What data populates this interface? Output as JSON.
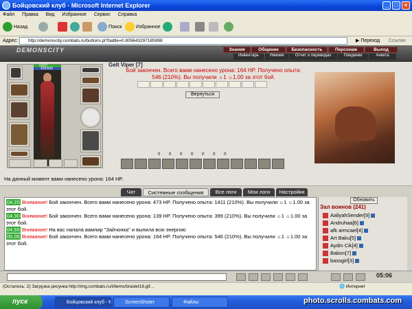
{
  "window": {
    "title": "Бойцовский клуб - Microsoft Internet Explorer"
  },
  "menu": [
    "Файл",
    "Правка",
    "Вид",
    "Избранное",
    "Сервис",
    "Справка"
  ],
  "toolbar": {
    "back": "Назад",
    "search": "Поиск",
    "favorites": "Избранное"
  },
  "address": {
    "label": "Адрес:",
    "url": "http://demonscity.combats.ru/buttons.pl?battle=0.805643297185998",
    "go": "Переход",
    "links": "Ссылки"
  },
  "game": {
    "logo": "DEMONSCITY",
    "nav_top": [
      "Знания",
      "Общение",
      "Безопасность",
      "Персонаж",
      "Выход"
    ],
    "nav_bottom": [
      "Инвентарь",
      "Умения",
      "Отчет о переводах",
      "Поединки",
      "Анкета"
    ]
  },
  "character": {
    "hp": "0/437",
    "mana": "459/600"
  },
  "battle": {
    "player": "Gelt Viper [7]",
    "line1": "Бой закончен. Всего вами нанесено урона: 164 HP. Получено опыта:",
    "line2": "546 (210%). Вы получили ☼1 ☼1.00 за этот бой.",
    "return_button": "Вернуться",
    "stats": [
      "0",
      "0",
      "0",
      "0",
      "0",
      "0",
      "0"
    ],
    "total_damage": "На данный момент вами нанесено урона: 164 HP."
  },
  "tabs": [
    "Чат",
    "Системные сообщения",
    "Все логи",
    "Мои логи",
    "Настройки"
  ],
  "chat": [
    {
      "time": "04.20",
      "warn": "Внимание!",
      "text": " Бой закончен. Всего вами нанесено урона: 473 HP. Получено опыта: 1411 (210%). Вы получили ☼1 ☼1.00 за этот бой."
    },
    {
      "time": "04.30",
      "warn": "Внимание!",
      "text": " Бой закончен. Всего вами нанесено урона: 139 HP. Получено опыта: 399 (210%). Вы получили ☼1 ☼1.00 за этот бой."
    },
    {
      "time": "04.55",
      "warn": "Внимание!",
      "text": " На вас напала вампир \"Зайчонка\" и выпила всю энергию"
    },
    {
      "time": "05.06",
      "warn": "Внимание!",
      "text": " Бой закончен. Всего вами нанесено урона: 164 HP. Получено опыта: 546 (210%). Вы получили ☼1 ☼1.00 за этот бой."
    }
  ],
  "players_panel": {
    "refresh": "Обновить",
    "room": "Зал воинов (241)",
    "players": [
      "AaliyahSender[9]",
      "Andruhaa[6]",
      "afk armcael[4]",
      "Art Baku[5]",
      "Aydin Cik[4]",
      "Babon[7]",
      "bassgirl[3]"
    ]
  },
  "clock": "05:06",
  "status": {
    "text": "(Осталось: 2) Загрузка рисунка http://img.combats.ru/i/items/braslet16.gif...",
    "zone": "Интернет"
  },
  "taskbar": {
    "start": "пуск",
    "tasks": [
      "Бойцовский клуб - M...",
      "ScreenShoter",
      "Файлы"
    ],
    "watermark": "photo.scrolls.combats.com"
  },
  "colors": {
    "accent": "#0a46d8",
    "warn": "#dd0000",
    "timestamp": "#33aa33"
  }
}
